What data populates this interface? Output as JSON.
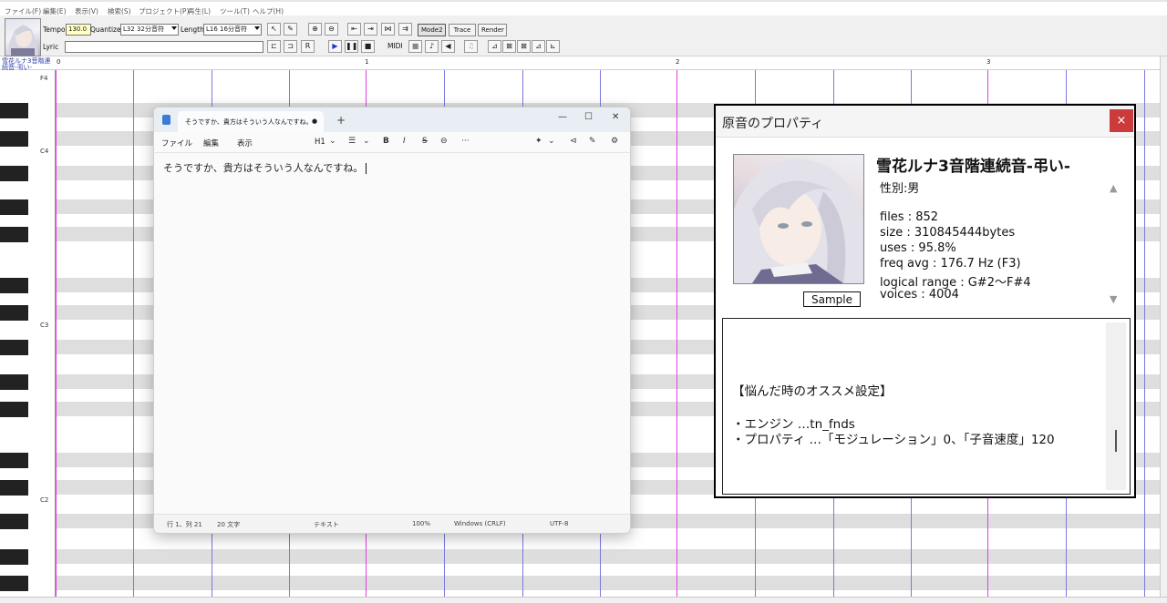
{
  "menu": [
    "ファイル(F)",
    "編集(E)",
    "表示(V)",
    "検索(S)",
    "プロジェクト(P)",
    "再生(L)",
    "ツール(T)",
    "ヘルプ(H)"
  ],
  "toolbar": {
    "tempo_label": "Tempo",
    "tempo_value": "130.0",
    "quantize_label": "Quantize",
    "quantize_value": "L32 32分音符",
    "length_label": "Length",
    "length_value": "L16 16分音符",
    "lyric_label": "Lyric",
    "lyric_value": "",
    "midi_label": "MIDI",
    "mode2": "Mode2",
    "trace": "Trace",
    "render": "Render"
  },
  "singer_label": "雪花ルナ3音階連続音-弔い-",
  "ruler": [
    "0",
    "1",
    "2",
    "3"
  ],
  "octaves": [
    "F4",
    "C4",
    "C3",
    "C2"
  ],
  "notepad": {
    "tab_title": "そうですか、貴方はそういう人なんですね。",
    "menu": [
      "ファイル",
      "編集",
      "表示"
    ],
    "heading": "H1",
    "body_text": "そうですか、貴方はそういう人なんですね。",
    "status": {
      "position": "行 1、列 21",
      "chars": "20 文字",
      "format": "テキスト",
      "zoom": "100%",
      "line_ending": "Windows (CRLF)",
      "encoding": "UTF-8"
    }
  },
  "voicebank": {
    "dialog_title": "原音のプロパティ",
    "close": "×",
    "name": "雪花ルナ3音階連続音-弔い-",
    "gender": "性別:男",
    "files": "files : 852",
    "size": "size :  310845444bytes",
    "uses": "uses : 95.8%",
    "freq": "freq avg : 176.7 Hz (F3)",
    "range": "logical range : G#2～F#4",
    "voices": "voices : 4004",
    "sample_button": "Sample",
    "readme_heading": "【悩んだ時のオススメ設定】",
    "readme_engine": "・エンジン …tn_fnds",
    "readme_property": "・プロパティ …「モジュレーション」0、「子音速度」120"
  }
}
